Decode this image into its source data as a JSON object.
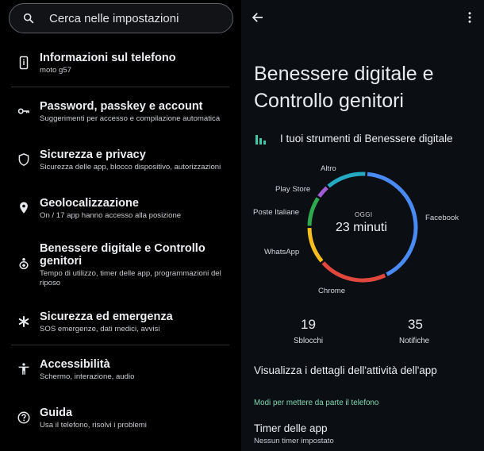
{
  "search": {
    "placeholder": "Cerca nelle impostazioni",
    "icon": "search-icon"
  },
  "settings": [
    {
      "title": "Informazioni sul telefono",
      "subtitle": "moto g57",
      "icon": "phone-info-icon"
    },
    {
      "title": "Password, passkey e account",
      "subtitle": "Suggerimenti per accesso e compilazione automatica",
      "icon": "key-icon"
    },
    {
      "title": "Sicurezza e privacy",
      "subtitle": "Sicurezza delle app, blocco dispositivo, autorizzazioni",
      "icon": "shield-icon"
    },
    {
      "title": "Geolocalizzazione",
      "subtitle": "On / 17 app hanno accesso alla posizione",
      "icon": "location-icon"
    },
    {
      "title": "Benessere digitale e Controllo genitori",
      "subtitle": "Tempo di utilizzo, timer delle app, programmazioni del riposo",
      "icon": "wellbeing-icon"
    },
    {
      "title": "Sicurezza ed emergenza",
      "subtitle": "SOS emergenze, dati medici, avvisi",
      "icon": "emergency-icon"
    },
    {
      "title": "Accessibilità",
      "subtitle": "Schermo, interazione, audio",
      "icon": "accessibility-icon"
    },
    {
      "title": "Guida",
      "subtitle": "Usa il telefono, risolvi i problemi",
      "icon": "help-icon"
    }
  ],
  "detail": {
    "title": "Benessere digitale e Controllo genitori",
    "tools_title": "I tuoi strumenti di Benessere digitale",
    "center_label": "OGGI",
    "center_value": "23 minuti",
    "unlocks_value": "19",
    "unlocks_label": "Sblocchi",
    "notifications_value": "35",
    "notifications_label": "Notifiche",
    "details_link": "Visualizza i dettagli dell'attività dell'app",
    "section_header": "Modi per mettere da parte il telefono",
    "timer_title": "Timer delle app",
    "timer_subtitle": "Nessun timer impostato"
  },
  "chart_data": {
    "type": "pie",
    "categories": [
      "Facebook",
      "Chrome",
      "WhatsApp",
      "Poste Italiane",
      "Play Store",
      "Altro"
    ],
    "values": [
      40,
      20,
      11,
      9,
      4,
      12
    ],
    "colors": [
      "#4a8af4",
      "#e0483e",
      "#f5bd1e",
      "#2fa94f",
      "#a05bd6",
      "#25a8c2"
    ],
    "title": ""
  }
}
